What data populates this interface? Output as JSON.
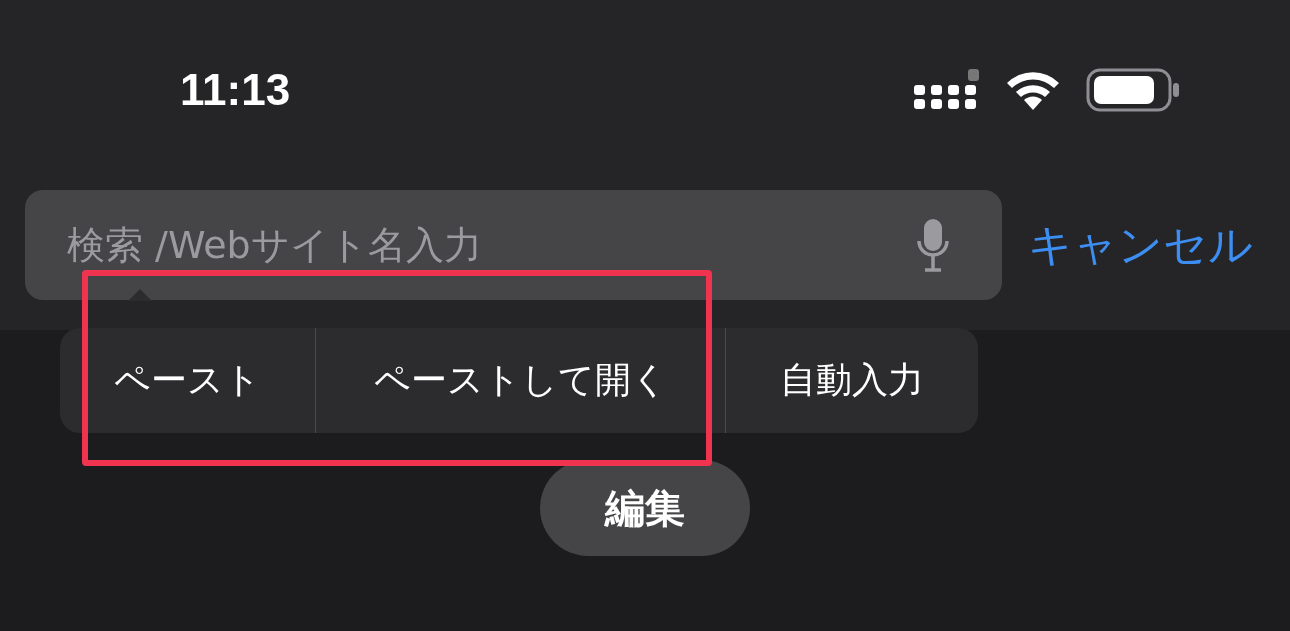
{
  "status_bar": {
    "time": "11:13"
  },
  "search": {
    "placeholder": "検索 /Webサイト名入力",
    "cancel": "キャンセル"
  },
  "context_menu": {
    "items": [
      {
        "label": "ペースト"
      },
      {
        "label": "ペーストして開く"
      },
      {
        "label": "自動入力"
      }
    ]
  },
  "edit_button": "編集"
}
